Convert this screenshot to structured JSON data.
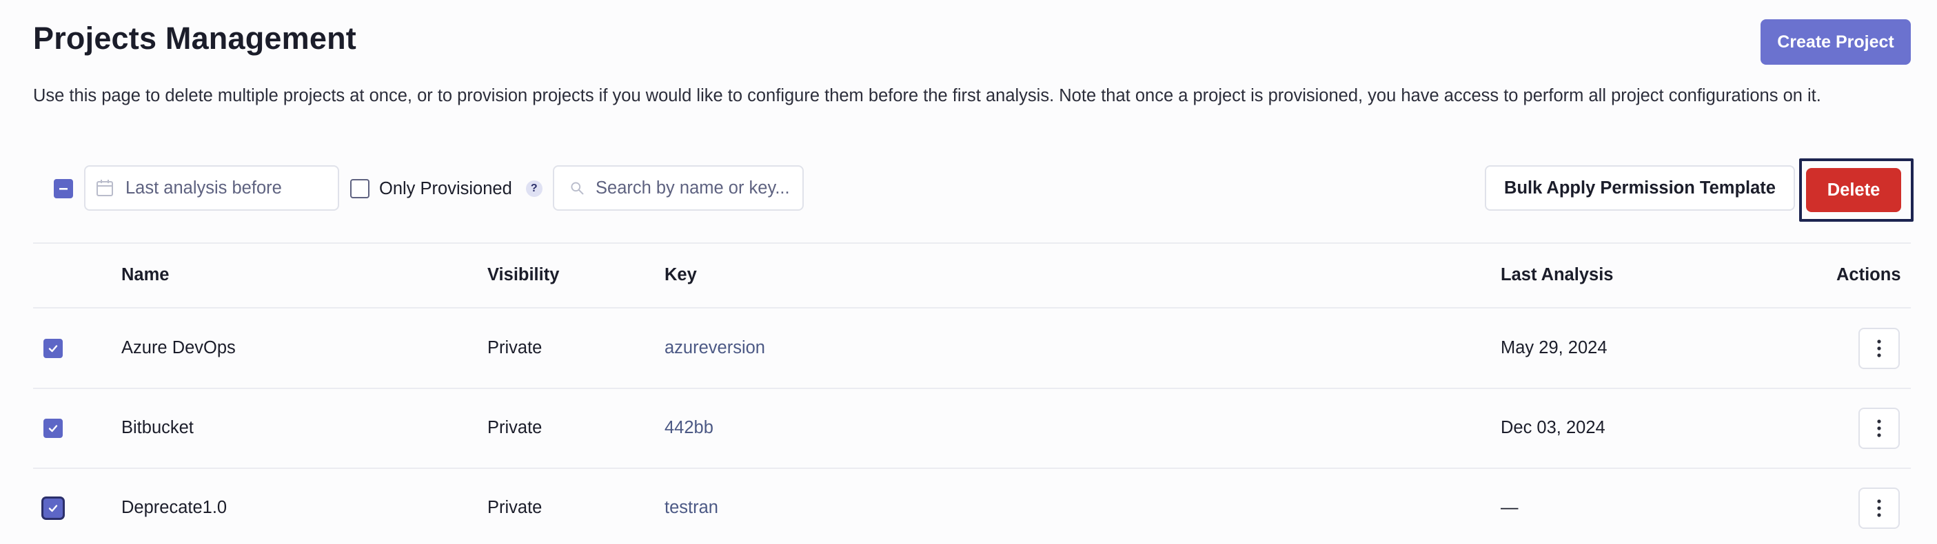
{
  "header": {
    "title": "Projects Management",
    "create_label": "Create Project",
    "description": "Use this page to delete multiple projects at once, or to provision projects if you would like to configure them before the first analysis. Note that once a project is provisioned, you have access to perform all project configurations on it."
  },
  "toolbar": {
    "date_placeholder": "Last analysis before",
    "only_provisioned_label": "Only Provisioned",
    "help_glyph": "?",
    "search_placeholder": "Search by name or key...",
    "bulk_label": "Bulk Apply Permission Template",
    "delete_label": "Delete"
  },
  "table": {
    "columns": {
      "name": "Name",
      "visibility": "Visibility",
      "key": "Key",
      "last_analysis": "Last Analysis",
      "actions": "Actions"
    },
    "rows": [
      {
        "name": "Azure DevOps",
        "visibility": "Private",
        "key": "azureversion",
        "last_analysis": "May 29, 2024",
        "selected": true
      },
      {
        "name": "Bitbucket",
        "visibility": "Private",
        "key": "442bb",
        "last_analysis": "Dec 03, 2024",
        "selected": true
      },
      {
        "name": "Deprecate1.0",
        "visibility": "Private",
        "key": "testran",
        "last_analysis": "—",
        "selected": true
      }
    ]
  },
  "colors": {
    "primary": "#6b72cf",
    "danger": "#d02f2a",
    "checkbox": "#5d66c6",
    "key_text": "#4c5985"
  }
}
